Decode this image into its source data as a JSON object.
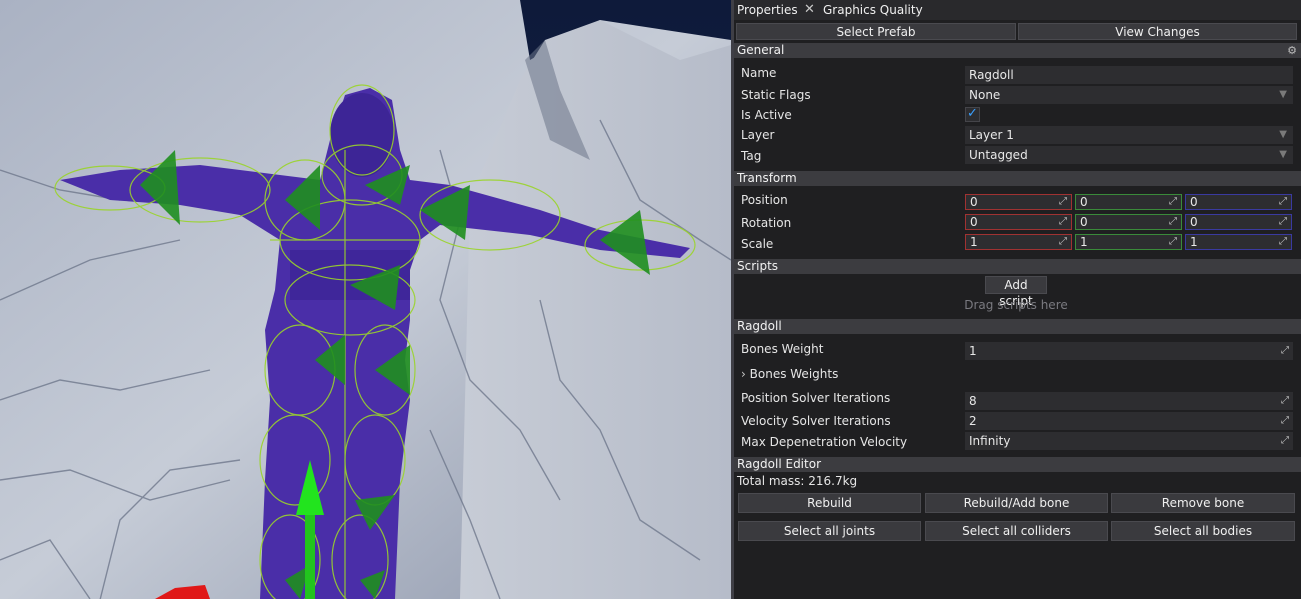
{
  "tabs": [
    {
      "label": "Properties"
    },
    {
      "label": "Graphics Quality"
    }
  ],
  "top_buttons": {
    "select_prefab": "Select Prefab",
    "view_changes": "View Changes"
  },
  "general": {
    "header": "General",
    "name_label": "Name",
    "name_value": "Ragdoll",
    "static_flags_label": "Static Flags",
    "static_flags_value": "None",
    "is_active_label": "Is Active",
    "is_active_checked": true,
    "layer_label": "Layer",
    "layer_value": "Layer 1",
    "tag_label": "Tag",
    "tag_value": "Untagged"
  },
  "transform": {
    "header": "Transform",
    "position_label": "Position",
    "position": [
      "0",
      "0",
      "0"
    ],
    "rotation_label": "Rotation",
    "rotation": [
      "0",
      "0",
      "0"
    ],
    "scale_label": "Scale",
    "scale": [
      "1",
      "1",
      "1"
    ]
  },
  "scripts": {
    "header": "Scripts",
    "add_script": "Add script",
    "drag_hint": "Drag scripts here"
  },
  "ragdoll": {
    "header": "Ragdoll",
    "bones_weight_label": "Bones Weight",
    "bones_weight_value": "1",
    "bones_weights_label": "Bones Weights",
    "position_iter_label": "Position Solver Iterations",
    "position_iter_value": "8",
    "velocity_iter_label": "Velocity Solver Iterations",
    "velocity_iter_value": "2",
    "max_depen_label": "Max Depenetration Velocity",
    "max_depen_value": "Infinity"
  },
  "ragdoll_editor": {
    "header": "Ragdoll Editor",
    "total_mass": "Total mass: 216.7kg",
    "buttons": {
      "rebuild": "Rebuild",
      "rebuild_add_bone": "Rebuild/Add bone",
      "remove_bone": "Remove bone",
      "select_all_joints": "Select all joints",
      "select_all_colliders": "Select all colliders",
      "select_all_bodies": "Select all bodies"
    }
  },
  "colors": {
    "panel_bg": "#1f1f21",
    "section_bg": "#3c3c40",
    "field_bg": "#2d2d30",
    "accent_check": "#3aa0ff",
    "axis_x": "#a03232",
    "axis_y": "#3a8a3a",
    "axis_z": "#3a3aa0",
    "character": "#4a2ea8",
    "gizmo_green": "#22c41e",
    "gizmo_red": "#e01818"
  },
  "icons": {
    "tab_close": "close-icon",
    "section_settings": "gear-icon",
    "dropdown": "chevron-down-icon",
    "expand": "expand-diagonal-icon",
    "tree_toggle": "chevron-right-icon",
    "check": "checkmark-icon"
  }
}
